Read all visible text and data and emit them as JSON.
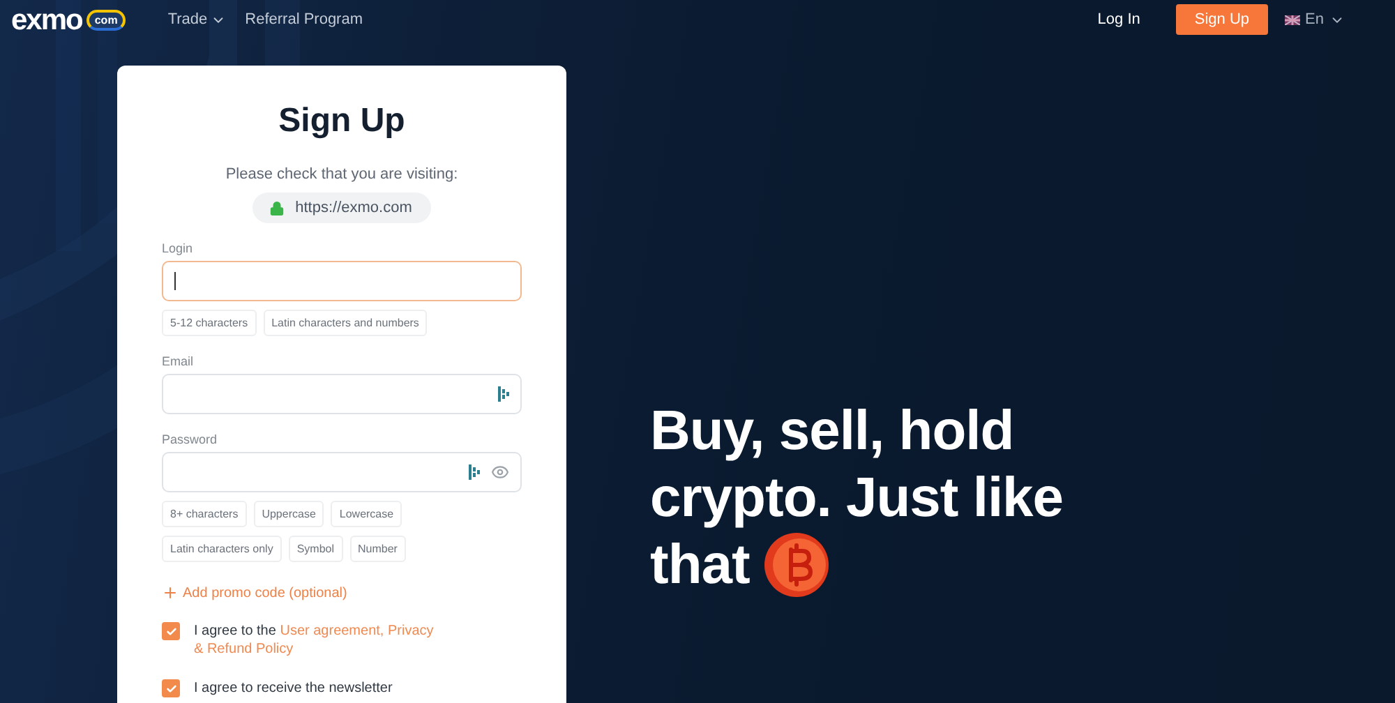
{
  "header": {
    "logo": {
      "word": "exmo",
      "badge": "com"
    },
    "nav": [
      {
        "label": "Trade",
        "dropdown": true
      },
      {
        "label": "Referral Program",
        "dropdown": false
      }
    ],
    "login": "Log In",
    "signup": "Sign Up",
    "language": "En"
  },
  "form": {
    "title": "Sign Up",
    "notice": "Please check that you are visiting:",
    "url": "https://exmo.com",
    "fields": [
      {
        "label": "Login",
        "focused": true,
        "manager_icon": false,
        "eye_icon": false,
        "hints": [
          [
            "5-12 characters",
            "Latin characters and numbers"
          ]
        ]
      },
      {
        "label": "Email",
        "focused": false,
        "manager_icon": true,
        "eye_icon": false
      },
      {
        "label": "Password",
        "focused": false,
        "manager_icon": true,
        "eye_icon": true,
        "hints": [
          [
            "8+ characters",
            "Uppercase",
            "Lowercase"
          ],
          [
            "Latin characters only",
            "Symbol",
            "Number"
          ]
        ]
      }
    ],
    "promo": "Add promo code (optional)",
    "agreements": [
      {
        "text": "I agree to the ",
        "links": [
          "User agreement, Privacy",
          "& Refund Policy"
        ],
        "checked": true
      },
      {
        "text": "I agree to receive the newsletter",
        "checked": true
      }
    ]
  },
  "hero": {
    "lines": [
      "Buy, sell, hold",
      "crypto. Just like",
      "that"
    ]
  }
}
